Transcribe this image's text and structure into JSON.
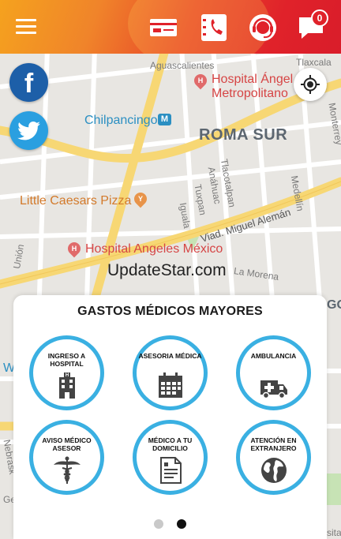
{
  "header": {
    "menu_icon": "hamburger-menu-icon",
    "icons": [
      "id-card-icon",
      "phone-book-icon",
      "support-headset-icon",
      "chat-bubble-icon"
    ],
    "notification_count": "0",
    "colors": {
      "start": "#f5a21e",
      "end": "#d91d2a"
    }
  },
  "social": {
    "facebook": "f",
    "twitter_icon": "twitter-bird-icon"
  },
  "map": {
    "labels": {
      "aguascalientes": "Aguascalientes",
      "tlaxcala": "Tlaxcala",
      "hospital_angel_1": "Hospital Ángel",
      "hospital_angel_2": "Metropolitano",
      "chilpancingo": "Chilpancingo",
      "metro": "M",
      "roma_sur": "ROMA SUR",
      "monterrey": "Monterrey",
      "tlacotalpan": "Tlacotalpan",
      "anahuac": "Anáhuac",
      "tuxpan": "Tuxpan",
      "iguala": "Iguala",
      "medellin": "Medellín",
      "little_caesars": "Little Caesars Pizza",
      "viad": "Viad. Miguel Alemán",
      "union": "Unión",
      "hospital_angeles_mexico": "Hospital Angeles México",
      "la_morena": "La Morena",
      "nebrask": "Nebrask",
      "sita": "sita",
      "go": "GO",
      "w": "W",
      "ge": "Ge"
    },
    "watermark": "UpdateStar.com",
    "colors": {
      "road_major": "#f7d774",
      "road_minor": "#ffffff",
      "park": "#c7e3b5",
      "base": "#e8e6e2"
    }
  },
  "panel": {
    "title": "GASTOS MÉDICOS MAYORES",
    "services": [
      {
        "label": "INGRESO A HOSPITAL",
        "icon": "hospital-building-icon"
      },
      {
        "label": "ASESORIA MÉDICA",
        "icon": "calendar-icon"
      },
      {
        "label": "AMBULANCIA",
        "icon": "ambulance-icon"
      },
      {
        "label": "AVISO MÉDICO ASESOR",
        "icon": "caduceus-icon"
      },
      {
        "label": "MÉDICO A TU DOMICILIO",
        "icon": "document-icon"
      },
      {
        "label": "ATENCIÓN EN EXTRANJERO",
        "icon": "globe-icon"
      }
    ],
    "accent": "#3ab0e2",
    "pager": {
      "pages": 2,
      "active": 2
    }
  }
}
